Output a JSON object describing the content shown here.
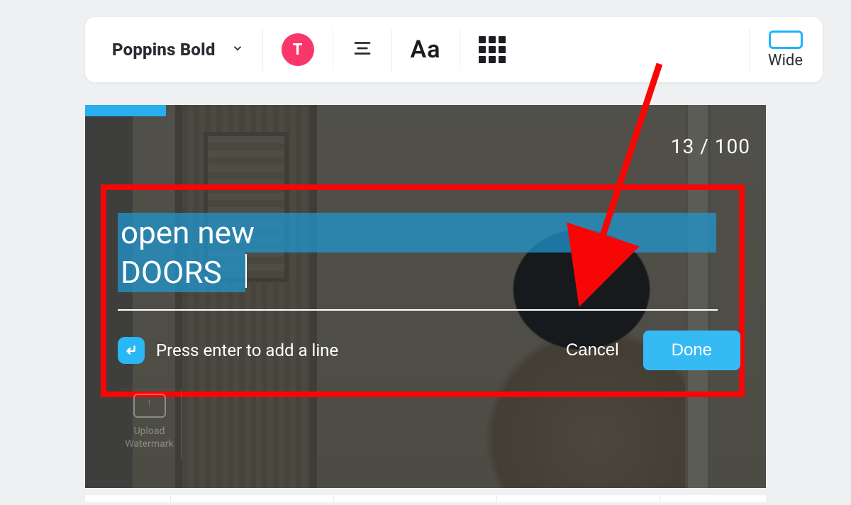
{
  "toolbar": {
    "font_name": "Poppins Bold",
    "text_color_label": "T",
    "case_label": "Aa",
    "aspect_label": "Wide"
  },
  "canvas": {
    "char_count": "13 / 100",
    "text_line1": "open new",
    "text_line2": "DOORS",
    "helper_text": "Press enter to add a line",
    "cancel_label": "Cancel",
    "done_label": "Done",
    "watermark_label_1": "Upload",
    "watermark_label_2": "Watermark"
  }
}
